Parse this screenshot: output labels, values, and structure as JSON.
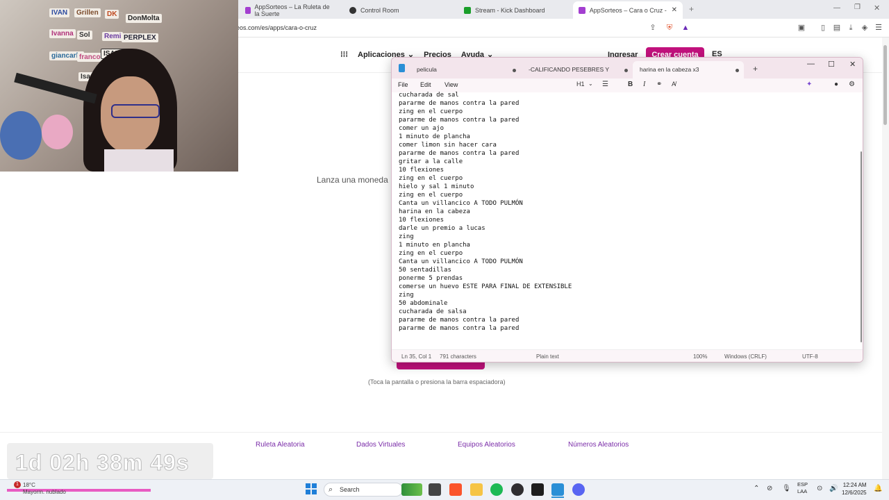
{
  "browser": {
    "tabs": [
      {
        "title": "AppSorteos – La Ruleta de la Suerte",
        "active": false
      },
      {
        "title": "Control Room",
        "active": false
      },
      {
        "title": "Stream - Kick Dashboard",
        "active": false
      },
      {
        "title": "AppSorteos – Cara o Cruz - Tira:",
        "active": true
      }
    ],
    "new_tab": "+",
    "url": "eos.com/es/apps/cara-o-cruz"
  },
  "site": {
    "nav": {
      "apps": "Aplicaciones",
      "prices": "Precios",
      "help": "Ayuda",
      "login": "Ingresar",
      "signup": "Crear cuenta",
      "lang": "ES"
    },
    "hero_text": "Lanza una moneda",
    "hint": "(Toca la pantalla o presiona la barra espaciadora)",
    "footer_links": [
      "Ruleta Aleatoria",
      "Dados Virtuales",
      "Equipos Aleatorios",
      "Números Aleatorios"
    ]
  },
  "webcam": {
    "wall_notes": [
      "IVAN",
      "Grillen",
      "DK",
      "DonMolta",
      "Ivanna",
      "Sol",
      "Remi",
      "PERPLEX",
      "giancarlo",
      "franco",
      "ISABEL",
      "Isaac"
    ]
  },
  "countdown": "1d 02h 38m 49s",
  "notepad": {
    "tabs": [
      {
        "title": "pelicula",
        "active": false
      },
      {
        "title": "-CALIFICANDO PESEBRES Y ARBOLE",
        "active": false
      },
      {
        "title": "harina en la cabeza x3",
        "active": true
      }
    ],
    "menu": [
      "File",
      "Edit",
      "View"
    ],
    "heading_label": "H1",
    "lines": [
      "cucharada de sal",
      "pararme de manos contra la pared",
      "zing en el cuerpo",
      "pararme de manos contra la pared",
      "comer un ajo",
      "1 minuto de plancha",
      "comer limon sin hacer cara",
      "pararme de manos contra la pared",
      "gritar a la calle",
      "10 flexiones",
      "zing en el cuerpo",
      "hielo y sal 1 minuto",
      "zing en el cuerpo",
      "Canta un villancico A TODO PULMÓN",
      "harina en la cabeza",
      "10 flexiones",
      "darle un premio a lucas",
      "zing",
      "1 minuto en plancha",
      "zing en el cuerpo",
      "Canta un villancico A TODO PULMÓN",
      "50 sentadillas",
      "ponerme 5 prendas",
      "comerse un huevo ESTE PARA FINAL DE EXTENSIBLE",
      "zing",
      "50 abdominale",
      "cucharada de salsa",
      "pararme de manos contra la pared",
      "pararme de manos contra la pared"
    ],
    "status": {
      "position": "Ln 35, Col 1",
      "chars": "791 characters",
      "format": "Plain text",
      "zoom": "100%",
      "line_ending": "Windows (CRLF)",
      "encoding": "UTF-8"
    }
  },
  "taskbar": {
    "weather_temp": "18°C",
    "weather_desc": "Mayorm. nublado",
    "search": "Search",
    "lang_line1": "ESP",
    "lang_line2": "LAA",
    "time": "12:24 AM",
    "date": "12/6/2025",
    "notif_count": "1"
  },
  "colors": {
    "brand": "#c2127d",
    "footer_link": "#7a2ca8",
    "notepad_tabbar": "#f3e5ec"
  }
}
